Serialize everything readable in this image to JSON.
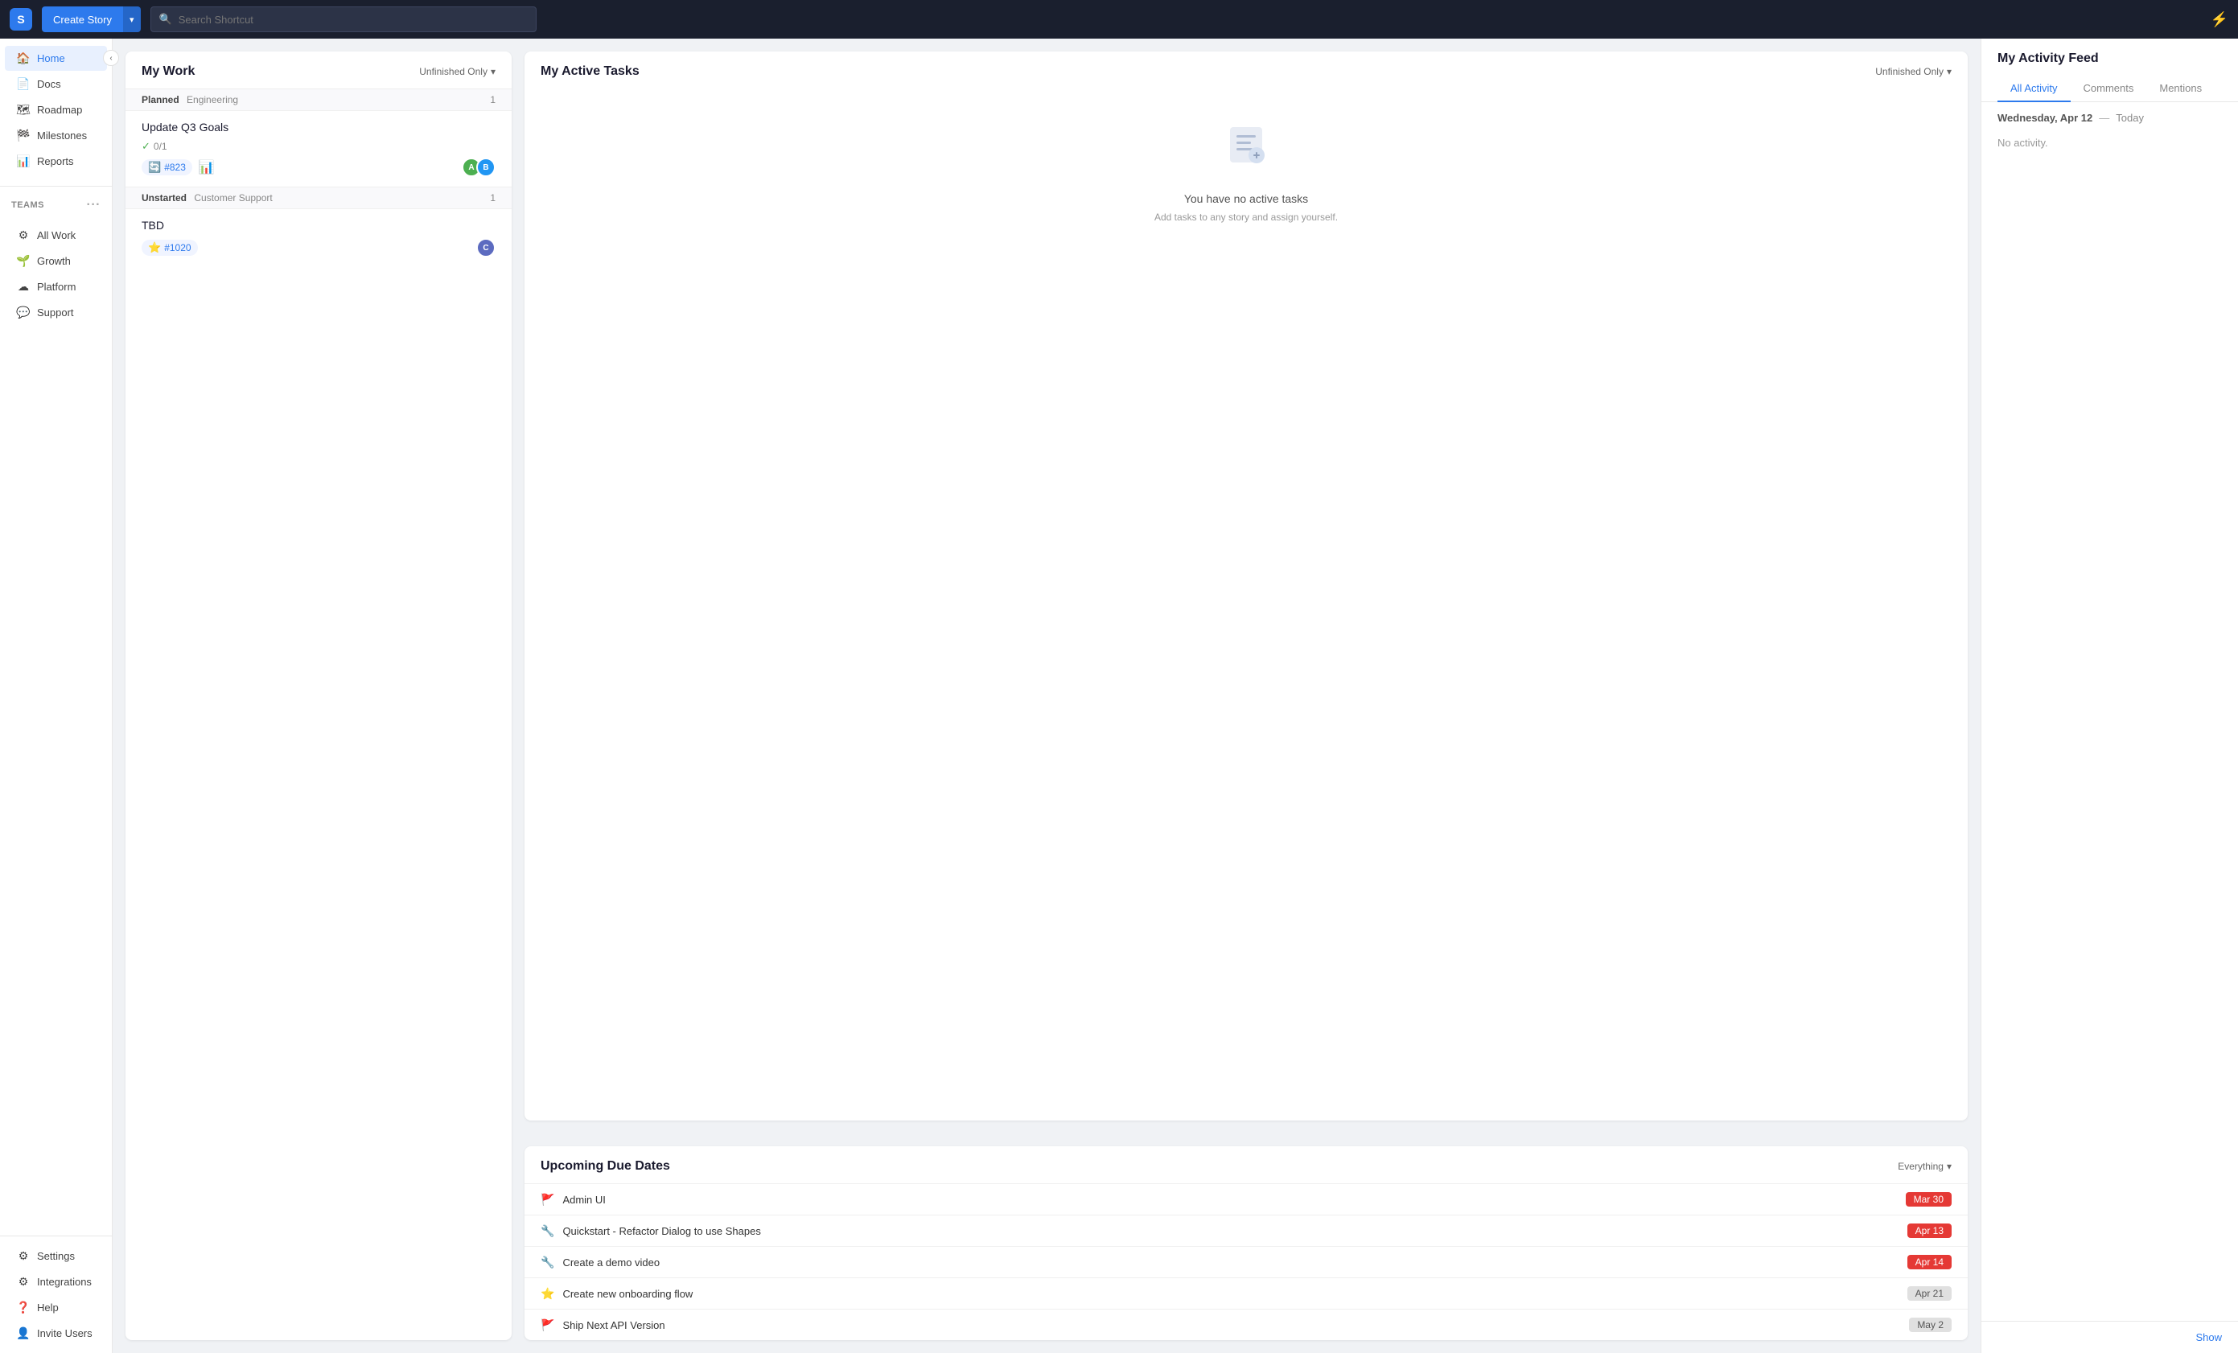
{
  "app": {
    "logo": "S",
    "logo_bg": "#2d7aed"
  },
  "topnav": {
    "create_story_label": "Create Story",
    "dropdown_arrow": "▾",
    "search_placeholder": "Search Shortcut",
    "lightning_icon": "⚡"
  },
  "sidebar": {
    "main_items": [
      {
        "id": "home",
        "label": "Home",
        "icon": "🏠",
        "active": true
      },
      {
        "id": "docs",
        "label": "Docs",
        "icon": "📄",
        "active": false
      },
      {
        "id": "roadmap",
        "label": "Roadmap",
        "icon": "🗺",
        "active": false
      },
      {
        "id": "milestones",
        "label": "Milestones",
        "icon": "🏁",
        "active": false
      },
      {
        "id": "reports",
        "label": "Reports",
        "icon": "📊",
        "active": false
      }
    ],
    "teams_header": "Teams",
    "teams_more": "···",
    "team_items": [
      {
        "id": "allwork",
        "label": "All Work",
        "icon": "⚙",
        "active": false
      },
      {
        "id": "growth",
        "label": "Growth",
        "icon": "🌱",
        "active": false
      },
      {
        "id": "platform",
        "label": "Platform",
        "icon": "☁",
        "active": false
      },
      {
        "id": "support",
        "label": "Support",
        "icon": "💬",
        "active": false
      }
    ],
    "bottom_items": [
      {
        "id": "settings",
        "label": "Settings",
        "icon": "⚙"
      },
      {
        "id": "integrations",
        "label": "Integrations",
        "icon": "⚙"
      },
      {
        "id": "help",
        "label": "Help",
        "icon": "❓"
      },
      {
        "id": "invite",
        "label": "Invite Users",
        "icon": "👤"
      }
    ]
  },
  "my_work": {
    "title": "My Work",
    "filter_label": "Unfinished Only",
    "sections": [
      {
        "state": "Planned",
        "team": "Engineering",
        "count": 1,
        "stories": [
          {
            "title": "Update Q3 Goals",
            "check_label": "0/1",
            "tag": "#823",
            "tag_icon": "🔄",
            "has_chart": true,
            "avatars": [
              "#4caf50",
              "#2196f3"
            ]
          }
        ]
      },
      {
        "state": "Unstarted",
        "team": "Customer Support",
        "count": 1,
        "stories": [
          {
            "title": "TBD",
            "check_label": null,
            "tag": "#1020",
            "tag_icon": "⭐",
            "has_chart": false,
            "avatars": [
              "#5c6bc0"
            ]
          }
        ]
      }
    ]
  },
  "active_tasks": {
    "title": "My Active Tasks",
    "filter_label": "Unfinished Only",
    "empty_title": "You have no active tasks",
    "empty_subtitle": "Add tasks to any story and assign yourself."
  },
  "upcoming": {
    "title": "Upcoming Due Dates",
    "filter_label": "Everything",
    "items": [
      {
        "icon": "🚩",
        "name": "Admin UI",
        "date": "Mar 30",
        "badge": "red"
      },
      {
        "icon": "🔧",
        "name": "Quickstart - Refactor Dialog to use Shapes",
        "date": "Apr 13",
        "badge": "orange"
      },
      {
        "icon": "🔧",
        "name": "Create a demo video",
        "date": "Apr 14",
        "badge": "orange"
      },
      {
        "icon": "⭐",
        "name": "Create new onboarding flow",
        "date": "Apr 21",
        "badge": "none"
      },
      {
        "icon": "🚩",
        "name": "Ship Next API Version",
        "date": "May 2",
        "badge": "none"
      }
    ]
  },
  "activity_feed": {
    "title": "My Activity Feed",
    "tabs": [
      {
        "id": "all",
        "label": "All Activity",
        "active": true
      },
      {
        "id": "comments",
        "label": "Comments",
        "active": false
      },
      {
        "id": "mentions",
        "label": "Mentions",
        "active": false
      }
    ],
    "date_header": "Wednesday, Apr 12",
    "date_dash": "—",
    "date_today": "Today",
    "empty_message": "No activity.",
    "show_more": "Show"
  }
}
